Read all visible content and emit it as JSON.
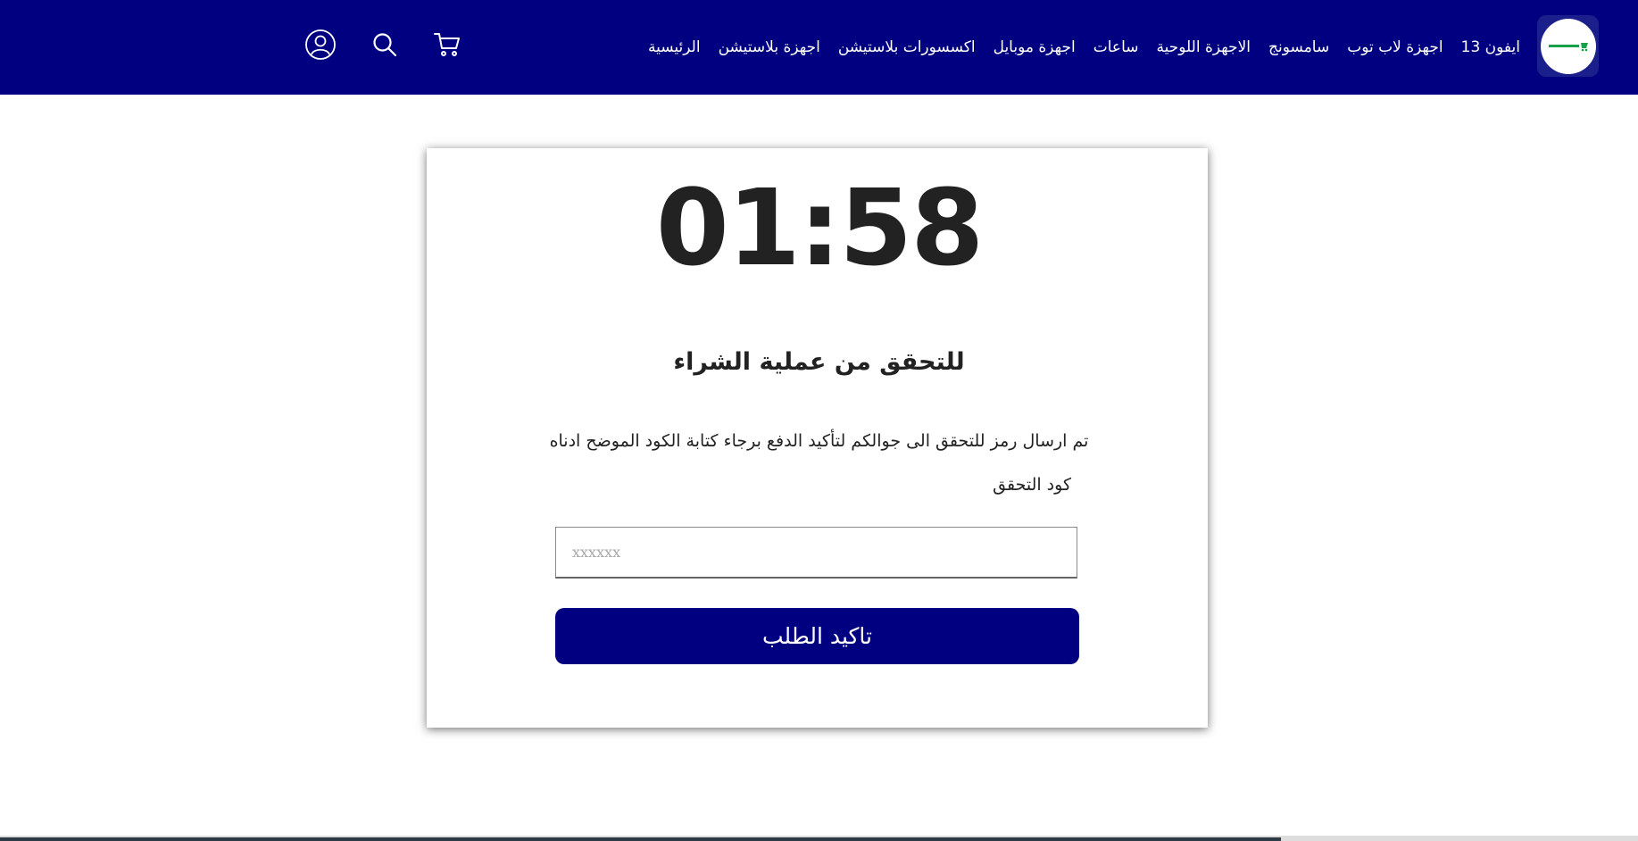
{
  "header": {
    "logo_icon": "store-logo-icon",
    "nav": [
      "الرئيسية",
      "اجهزة بلاستيشن",
      "اكسسورات بلاستيشن",
      "اجهزة موبايل",
      "ساعات",
      "الاجهزة اللوحية",
      "سامسونج",
      "اجهزة لاب توب",
      "ايفون 13"
    ],
    "icons": [
      "cart-icon",
      "search-icon",
      "account-icon"
    ],
    "background_color": "#000080"
  },
  "verification": {
    "timer": "01:58",
    "title": "للتحقق من عملية الشراء",
    "description": "تم ارسال رمز للتحقق الى جوالكم لتأكيد الدفع برجاء كتابة الكود الموضح ادناه",
    "code_label": "كود التحقق",
    "code_placeholder": "xxxxxx",
    "code_value": "",
    "confirm_label": "تاكيد الطلب",
    "button_color": "#000080"
  }
}
